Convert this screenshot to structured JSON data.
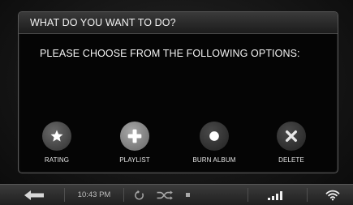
{
  "dialog": {
    "title": "WHAT DO YOU WANT TO DO?",
    "message": "PLEASE CHOOSE FROM THE FOLLOWING OPTIONS:",
    "options": [
      {
        "label": "RATING",
        "icon": "star-icon"
      },
      {
        "label": "PLAYLIST",
        "icon": "plus-icon"
      },
      {
        "label": "BURN ALBUM",
        "icon": "disc-icon"
      },
      {
        "label": "DELETE",
        "icon": "x-icon"
      }
    ]
  },
  "status_bar": {
    "time": "10:43 PM",
    "icons": [
      "back-arrow-icon",
      "repeat-icon",
      "shuffle-icon",
      "stop-icon",
      "signal-icon",
      "wifi-icon"
    ]
  },
  "colors": {
    "background": "#101010",
    "dialog_header": "#2e2e2e",
    "option_button": "#555555"
  }
}
